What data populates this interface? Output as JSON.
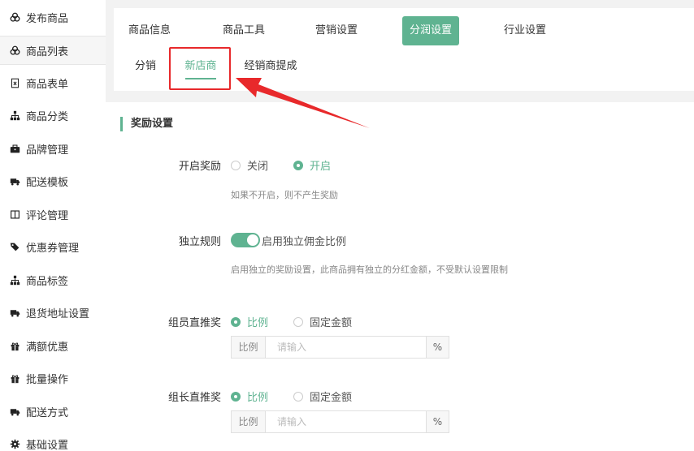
{
  "sidebar": {
    "items": [
      {
        "label": "发布商品",
        "icon": "cubes-icon"
      },
      {
        "label": "商品列表",
        "icon": "cubes-icon",
        "active": true
      },
      {
        "label": "商品表单",
        "icon": "excel-file-icon"
      },
      {
        "label": "商品分类",
        "icon": "sitemap-icon"
      },
      {
        "label": "品牌管理",
        "icon": "briefcase-icon"
      },
      {
        "label": "配送模板",
        "icon": "truck-icon"
      },
      {
        "label": "评论管理",
        "icon": "columns-icon"
      },
      {
        "label": "优惠券管理",
        "icon": "tags-icon"
      },
      {
        "label": "商品标签",
        "icon": "sitemap-icon"
      },
      {
        "label": "退货地址设置",
        "icon": "truck-icon"
      },
      {
        "label": "满额优惠",
        "icon": "gift-icon"
      },
      {
        "label": "批量操作",
        "icon": "gift-icon"
      },
      {
        "label": "配送方式",
        "icon": "truck-icon"
      },
      {
        "label": "基础设置",
        "icon": "gear-icon"
      }
    ]
  },
  "tabs": {
    "primary": [
      {
        "label": "商品信息"
      },
      {
        "label": "商品工具"
      },
      {
        "label": "营销设置"
      },
      {
        "label": "分润设置",
        "active": true
      },
      {
        "label": "行业设置"
      }
    ],
    "secondary": [
      {
        "label": "分销"
      },
      {
        "label": "新店商",
        "active": true
      },
      {
        "label": "经销商提成"
      }
    ]
  },
  "section": {
    "title": "奖励设置"
  },
  "form": {
    "enable_reward": {
      "label": "开启奖励",
      "options": [
        "关闭",
        "开启"
      ],
      "selected": "开启",
      "hint": "如果不开启，则不产生奖励"
    },
    "independent_rule": {
      "label": "独立规则",
      "switch_text": "启用独立佣金比例",
      "enabled": true,
      "hint": "启用独立的奖励设置，此商品拥有独立的分红金额，不受默认设置限制"
    },
    "member_direct": {
      "label": "组员直推奖",
      "options": [
        "比例",
        "固定金额"
      ],
      "selected": "比例",
      "prefix": "比例",
      "placeholder": "请输入",
      "suffix": "%"
    },
    "leader_direct": {
      "label": "组长直推奖",
      "options": [
        "比例",
        "固定金额"
      ],
      "selected": "比例",
      "prefix": "比例",
      "placeholder": "请输入",
      "suffix": "%"
    }
  },
  "colors": {
    "accent": "#5fb391",
    "annotation": "#e8292b"
  }
}
